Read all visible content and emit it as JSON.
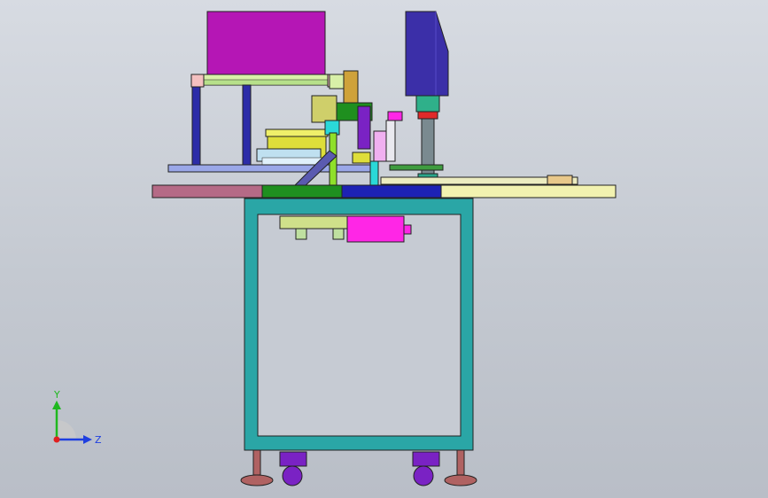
{
  "viewport": {
    "background_top": "#d7dbe2",
    "background_bottom": "#b9bec7"
  },
  "model": {
    "frame_color": "#2aa6a6",
    "hopper_color": "#b516b5",
    "motor_housing_color": "#3b2fa8",
    "table_colors": [
      "#b56a86",
      "#f2f2b0",
      "#1f8f1f",
      "#1d22b4"
    ],
    "feeder_bowl_color": "#dede3a",
    "control_box_color": "#ff26e6",
    "caster_color": "#7a22c4",
    "foot_color": "#b06262"
  },
  "triad": {
    "y_label": "Y",
    "z_label": "Z",
    "y_color": "#1fb81f",
    "z_color": "#1f3fe0",
    "origin_color": "#e01f1f"
  }
}
